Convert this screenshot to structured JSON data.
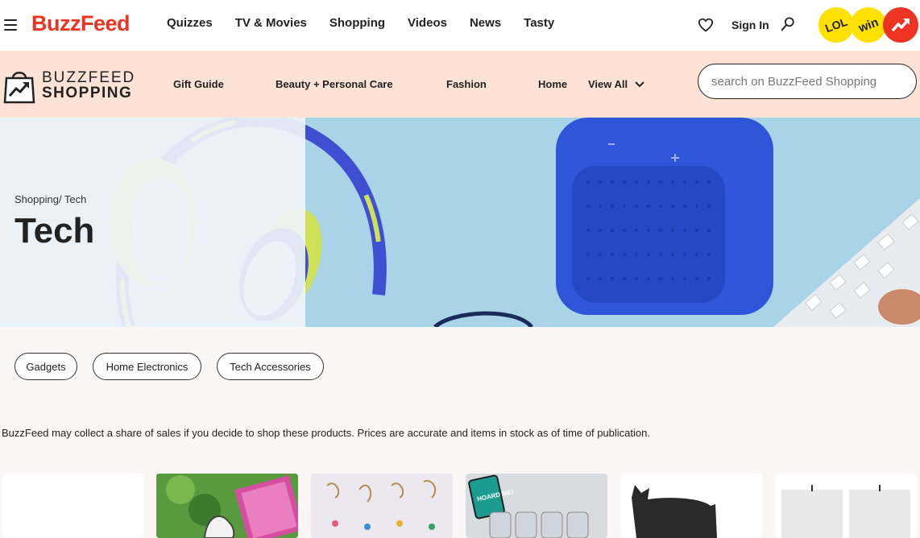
{
  "brand": {
    "logo_text": "BuzzFeed",
    "accent": "#ee3322",
    "yellow": "#ffe100"
  },
  "topnav": {
    "items": [
      {
        "label": "Quizzes"
      },
      {
        "label": "TV & Movies"
      },
      {
        "label": "Shopping"
      },
      {
        "label": "Videos"
      },
      {
        "label": "News"
      },
      {
        "label": "Tasty"
      }
    ],
    "signin_label": "Sign In",
    "badges": {
      "lol": "LOL",
      "win": "win"
    },
    "icons": [
      "hamburger-icon",
      "heart-icon",
      "search-icon",
      "trending-icon"
    ]
  },
  "shopbar": {
    "logo_line1": "BUZZFEED",
    "logo_line2": "SHOPPING",
    "items": [
      {
        "label": "Gift Guide"
      },
      {
        "label": "Beauty + Personal Care"
      },
      {
        "label": "Fashion"
      },
      {
        "label": "Home"
      }
    ],
    "view_all_label": "View All",
    "search_placeholder": "search on BuzzFeed Shopping",
    "background": "#fde2d6"
  },
  "hero": {
    "breadcrumb": "Shopping/ Tech",
    "title": "Tech"
  },
  "pills": [
    {
      "label": "Gadgets"
    },
    {
      "label": "Home Electronics"
    },
    {
      "label": "Tech Accessories"
    }
  ],
  "disclaimer": "BuzzFeed may collect a share of sales if you decide to shop these products. Prices are accurate and items in stock as of time of publication.",
  "cards": {
    "jar_label": "HOARD ME!"
  }
}
